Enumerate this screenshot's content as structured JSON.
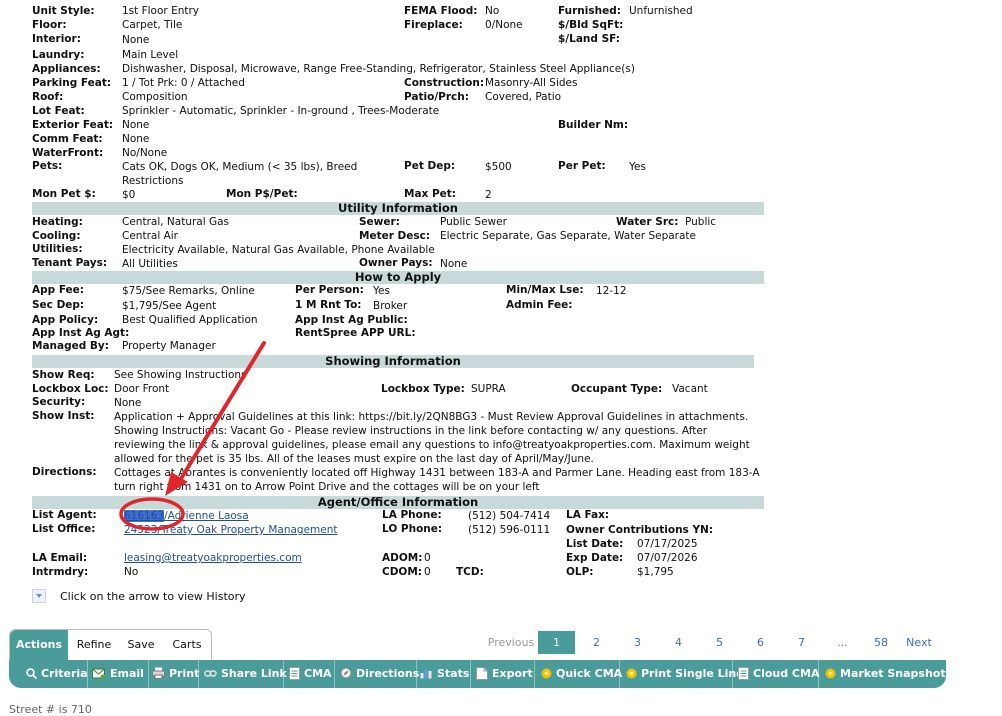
{
  "top": {
    "unit_style_label": "Unit Style:",
    "unit_style": "1st Floor Entry",
    "floor_label": "Floor:",
    "floor": "Carpet, Tile",
    "interior_label": "Interior:",
    "interior": "None",
    "laundry_label": "Laundry:",
    "laundry": "Main Level",
    "appliances_label": "Appliances:",
    "appliances": "Dishwasher, Disposal, Microwave, Range Free-Standing, Refrigerator, Stainless Steel Appliance(s)",
    "parking_label": "Parking Feat:",
    "parking": "1 / Tot Prk: 0 / Attached",
    "construction_label": "Construction:",
    "construction": "Masonry-All Sides",
    "roof_label": "Roof:",
    "roof": "Composition",
    "patio_label": "Patio/Prch:",
    "patio": "Covered, Patio",
    "lot_label": "Lot Feat:",
    "lot": "Sprinkler - Automatic, Sprinkler - In-ground , Trees-Moderate",
    "exterior_label": "Exterior Feat:",
    "exterior": "None",
    "builder_label": "Builder Nm:",
    "comm_label": "Comm Feat:",
    "comm": "None",
    "waterfront_label": "WaterFront:",
    "waterfront": "No/None",
    "pets_label": "Pets:",
    "pets_line1": "Cats OK, Dogs OK, Medium (< 35 lbs), Breed",
    "pets_line2": "Restrictions",
    "pet_dep_label": "Pet Dep:",
    "pet_dep": "$500",
    "per_pet_label": "Per Pet:",
    "per_pet": "Yes",
    "mon_pet_label": "Mon Pet $:",
    "mon_pet": "$0",
    "mon_ppet_label": "Mon P$/Pet:",
    "max_pet_label": "Max Pet:",
    "max_pet": "2",
    "fema_label": "FEMA Flood:",
    "fema": "No",
    "fireplace_label": "Fireplace:",
    "fireplace": "0/None",
    "furnished_label": "Furnished:",
    "furnished": "Unfurnished",
    "bld_sqft_label": "$/Bld SqFt:",
    "land_sf_label": "$/Land SF:"
  },
  "utility": {
    "title": "Utility Information",
    "heating_label": "Heating:",
    "heating": "Central, Natural Gas",
    "sewer_label": "Sewer:",
    "sewer": "Public Sewer",
    "water_label": "Water Src:",
    "water": "Public",
    "cooling_label": "Cooling:",
    "cooling": "Central Air",
    "meter_label": "Meter Desc:",
    "meter": "Electric Separate, Gas Separate, Water Separate",
    "utilities_label": "Utilities:",
    "utilities": "Electricity Available, Natural Gas Available, Phone Available",
    "tenant_label": "Tenant Pays:",
    "tenant": "All Utilities",
    "owner_label": "Owner Pays:",
    "owner": "None"
  },
  "apply": {
    "title": "How to Apply",
    "app_fee_label": "App Fee:",
    "app_fee": "$75/See Remarks, Online",
    "per_person_label": "Per Person:",
    "per_person": "Yes",
    "minmax_label": "Min/Max Lse:",
    "minmax": "12-12",
    "sec_dep_label": "Sec Dep:",
    "sec_dep": "$1,795/See Agent",
    "rnt_to_label": "1 M Rnt To:",
    "rnt_to": "Broker",
    "admin_label": "Admin Fee:",
    "policy_label": "App Policy:",
    "policy": "Best Qualified Application",
    "inst_pub_label": "App Inst Ag Public:",
    "inst_agt_label": "App Inst Ag Agt:",
    "rentspree_label": "RentSpree APP URL:",
    "managed_label": "Managed By:",
    "managed": "Property Manager"
  },
  "showing": {
    "title": "Showing Information",
    "req_label": "Show Req:",
    "req": "See Showing Instructions",
    "lockbox_label": "Lockbox Loc:",
    "lockbox": "Door Front",
    "lb_type_label": "Lockbox Type:",
    "lb_type": "SUPRA",
    "occupant_label": "Occupant Type:",
    "occupant": "Vacant",
    "security_label": "Security:",
    "security": "None",
    "inst_label": "Show Inst:",
    "inst_1": "Application + Approval Guidelines at this link: https://bit.ly/2QN8BG3 - Must Review Approval Guidelines in attachments.",
    "inst_2": "Showing Instructions: Vacant Go - Please review instructions in the link before contacting w/ any questions. After",
    "inst_3": "reviewing the link & approval guidelines, please email any questions to info@treatyoakproperties.com. Maximum weight",
    "inst_4": "allowed for the pet is 35 lbs. All of the leases must expire on the last day of April/May/June.",
    "dir_label": "Directions:",
    "dir_1": "Cottages at Abrantes is conveniently located off Highway 1431 between 183-A and Parmer Lane. Heading east from 183-A",
    "dir_2": "turn right from 1431 on to Arrow Point Drive and the cottages will be on your left"
  },
  "agent": {
    "title": "Agent/Office Information",
    "list_agent_label": "List Agent:",
    "agent_id": "616163",
    "agent_name": "/Adrienne Laosa",
    "la_phone_label": "LA Phone:",
    "la_phone": "(512) 504-7414",
    "la_fax_label": "LA Fax:",
    "list_office_label": "List Office:",
    "office": "24523/Treaty Oak Property Management",
    "lo_phone_label": "LO Phone:",
    "lo_phone": "(512) 596-0111",
    "owner_contrib_label": "Owner Contributions YN:",
    "list_date_label": "List Date:",
    "list_date": "07/17/2025",
    "la_email_label": "LA Email:",
    "la_email": "leasing@treatyoakproperties.com",
    "adom_label": "ADOM:",
    "adom": "0",
    "exp_label": "Exp Date:",
    "exp": "07/07/2026",
    "intrmdry_label": "Intrmdry:",
    "intrmdry": "No",
    "cdom_label": "CDOM:",
    "cdom": "0",
    "tcd_label": "TCD:",
    "olp_label": "OLP:",
    "olp": "$1,795"
  },
  "history_text": "Click on the arrow to view History",
  "tabs": [
    "Actions",
    "Refine",
    "Save",
    "Carts"
  ],
  "pagination": {
    "previous": "Previous",
    "pages": [
      "1",
      "2",
      "3",
      "4",
      "5",
      "6",
      "7",
      "...",
      "58"
    ],
    "next": "Next"
  },
  "toolbar": [
    "Criteria",
    "Email",
    "Print",
    "Share Link",
    "CMA",
    "Directions",
    "Stats",
    "Export",
    "Quick CMA",
    "Print Single Line",
    "Cloud CMA",
    "Market Snapshot"
  ],
  "footer": "Street # is 710",
  "colors": {
    "accent": "#4a9c9a",
    "section_bar": "#c8d9da",
    "link": "#1f4f9a",
    "annotation": "#e0262a"
  }
}
